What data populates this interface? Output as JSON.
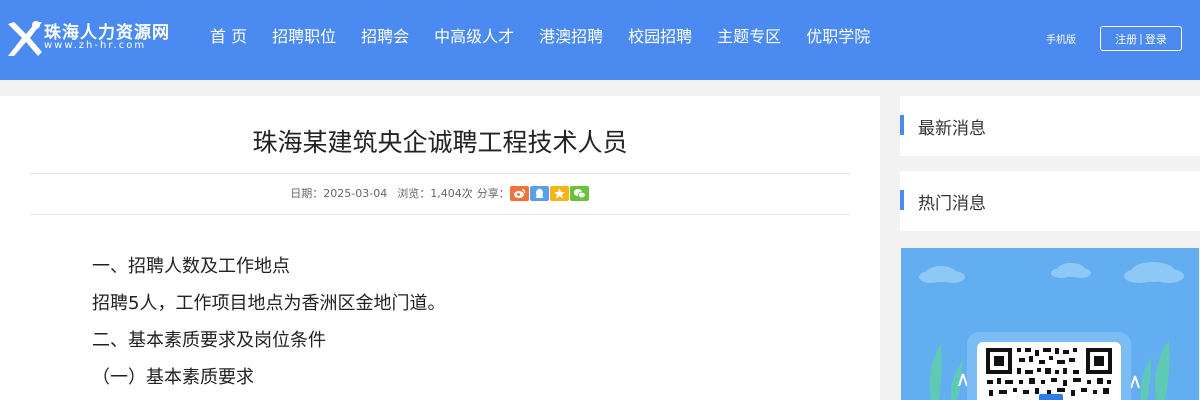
{
  "site": {
    "logo_name": "珠海人力资源网",
    "logo_url": "www.zh-hr.com"
  },
  "nav": {
    "items": [
      "首 页",
      "招聘职位",
      "招聘会",
      "中高级人才",
      "港澳招聘",
      "校园招聘",
      "主题专区",
      "优职学院"
    ]
  },
  "header_right": {
    "mobile": "手机版",
    "register": "注册",
    "separator": "|",
    "login": "登录"
  },
  "article": {
    "title": "珠海某建筑央企诚聘工程技术人员",
    "date_label": "日期：",
    "date": "2025-03-04",
    "views_label": "浏览：",
    "views": "1,404次",
    "share_label": "分享：",
    "share_icons": [
      {
        "name": "weibo-icon",
        "color": "#f0733a"
      },
      {
        "name": "qq-icon",
        "color": "#5aa0e8"
      },
      {
        "name": "qzone-icon",
        "color": "#f5b418"
      },
      {
        "name": "wechat-icon",
        "color": "#6ac23c"
      }
    ],
    "paragraphs": [
      "一、招聘人数及工作地点",
      "招聘5人，工作项目地点为香洲区金地门道。",
      "二、基本素质要求及岗位条件",
      "（一）基本素质要求"
    ]
  },
  "sidebar": {
    "latest_title": "最新消息",
    "hot_title": "热门消息"
  },
  "colors": {
    "header_bg": "#4b8af0",
    "qr_bg": "#62aef0"
  }
}
